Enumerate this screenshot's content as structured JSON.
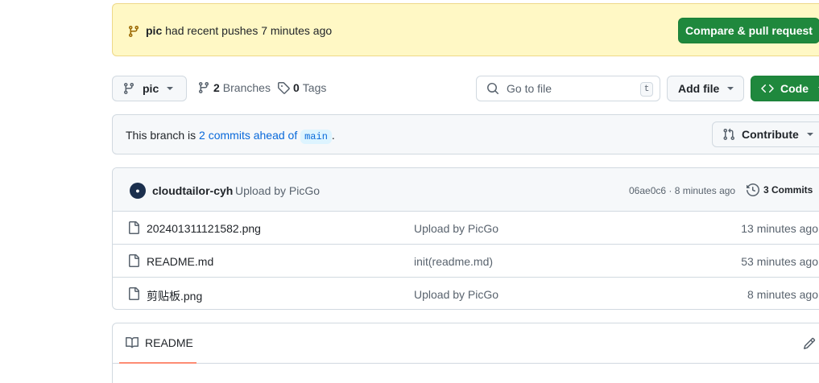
{
  "banner": {
    "branch": "pic",
    "text": "had recent pushes 7 minutes ago",
    "button": "Compare & pull request"
  },
  "toolbar": {
    "branch": "pic",
    "branches_count": "2",
    "branches_label": "Branches",
    "tags_count": "0",
    "tags_label": "Tags",
    "search_placeholder": "Go to file",
    "search_shortcut": "t",
    "add_file": "Add file",
    "code": "Code"
  },
  "ahead_bar": {
    "prefix": "This branch is",
    "link": "2 commits ahead of",
    "base": "main",
    "suffix": ".",
    "contribute": "Contribute"
  },
  "latest_commit": {
    "author": "cloudtailor-cyh",
    "message": "Upload by PicGo",
    "sha_time": "06ae0c6 · 8 minutes ago",
    "commits": "3 Commits"
  },
  "files": [
    {
      "name": "202401311121582.png",
      "message": "Upload by PicGo",
      "date": "13 minutes ago"
    },
    {
      "name": "README.md",
      "message": "init(readme.md)",
      "date": "53 minutes ago"
    },
    {
      "name": "剪贴板.png",
      "message": "Upload by PicGo",
      "date": "8 minutes ago"
    }
  ],
  "readme": {
    "tab": "README"
  },
  "icons": {
    "branch": "git-branch-icon",
    "tag": "tag-icon",
    "search": "search-icon",
    "file": "file-icon",
    "history": "history-icon",
    "book": "book-icon",
    "pencil": "pencil-icon",
    "pr": "git-pull-request-icon",
    "code": "code-icon"
  },
  "colors": {
    "green": "#1f883d",
    "link": "#0969da",
    "banner_bg": "#fff8c5"
  }
}
